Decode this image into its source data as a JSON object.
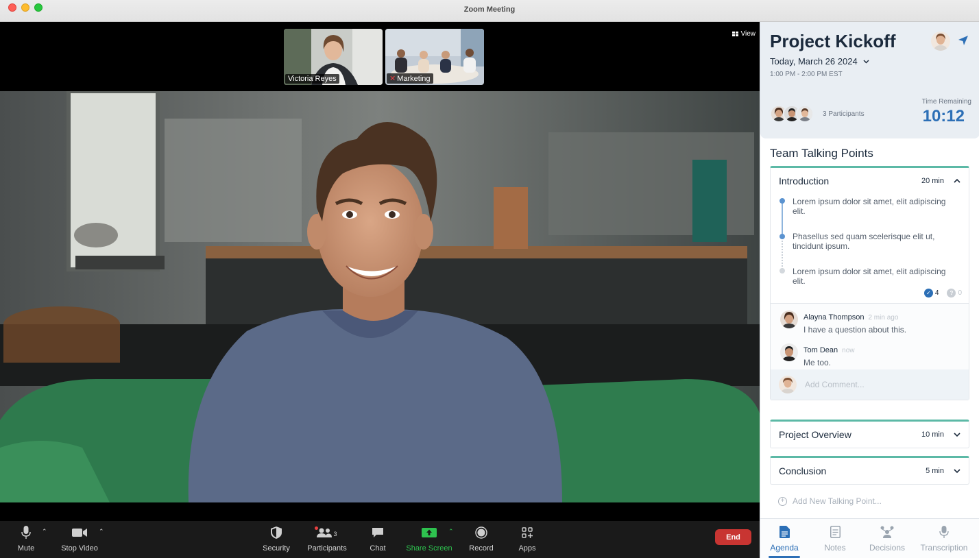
{
  "window": {
    "title": "Zoom Meeting"
  },
  "video": {
    "view_label": "View",
    "thumbnails": [
      {
        "name": "Victoria Reyes",
        "muted": false
      },
      {
        "name": "Marketing",
        "muted": true
      }
    ]
  },
  "toolbar": {
    "mute": "Mute",
    "stop_video": "Stop Video",
    "security": "Security",
    "participants": "Participants",
    "participants_count": "3",
    "chat": "Chat",
    "share_screen": "Share Screen",
    "record": "Record",
    "apps": "Apps",
    "end": "End"
  },
  "panel": {
    "title": "Project Kickoff",
    "date": "Today, March 26 2024",
    "time_range": "1:00 PM - 2:00 PM EST",
    "participants_label": "3 Participants",
    "time_remaining_label": "Time Remaining",
    "time_remaining": "10:12",
    "section_title": "Team Talking Points",
    "talking_points": [
      {
        "title": "Introduction",
        "duration": "20 min",
        "expanded": true,
        "points": [
          "Lorem ipsum dolor sit amet, elit adipiscing elit.",
          "Phasellus sed quam scelerisque elit ut, tincidunt ipsum.",
          "Lorem ipsum dolor sit amet, elit adipiscing elit."
        ],
        "votes_done": "4",
        "votes_open": "0",
        "comments": [
          {
            "author": "Alayna Thompson",
            "time": "2 min ago",
            "text": "I have a question about this."
          },
          {
            "author": "Tom Dean",
            "time": "now",
            "text": "Me too."
          }
        ]
      },
      {
        "title": "Project Overview",
        "duration": "10 min",
        "expanded": false
      },
      {
        "title": "Conclusion",
        "duration": "5 min",
        "expanded": false
      }
    ],
    "comment_placeholder": "Add Comment...",
    "add_point_label": "Add New Talking Point...",
    "tabs": [
      "Agenda",
      "Notes",
      "Decisions",
      "Transcription"
    ],
    "active_tab": "Agenda"
  },
  "colors": {
    "accent_blue": "#2c6fb6",
    "accent_teal": "#5cb9a6",
    "end_red": "#c83532",
    "share_green": "#2ec24f"
  }
}
